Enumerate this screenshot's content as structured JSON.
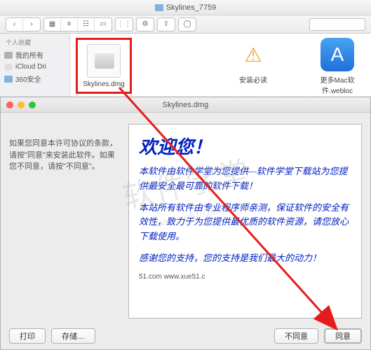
{
  "finder": {
    "title": "Skylines_7759",
    "sidebar": {
      "header": "个人收藏",
      "items": [
        {
          "label": "我的所有"
        },
        {
          "label": "iCloud Dri"
        },
        {
          "label": "360安全"
        }
      ]
    },
    "files": [
      {
        "label": "Skylines.dmg",
        "kind": "dmg"
      },
      {
        "label": "安装必读",
        "kind": "warning"
      },
      {
        "label": "更多Mac软件.webloc",
        "kind": "appstore"
      }
    ]
  },
  "dialog": {
    "title": "Skylines.dmg",
    "instruction": "如果您同意本许可协议的条款，请按\"同意\"来安装此软件。如果您不同意，请按\"不同意\"。",
    "license": {
      "heading": "欢迎您！",
      "p1": "本软件由软件学堂为您提供—软件学堂下载站为您提供最安全最可靠的软件下载！",
      "p2": "本站所有软件由专业程序师亲测，保证软件的安全有效性，致力于为您提供最优质的软件资源，请您放心下载使用。",
      "p3": "感谢您的支持，您的支持是我们最大的动力！",
      "url": "51.com www.xue51.c"
    },
    "buttons": {
      "print": "打印",
      "save": "存储…",
      "disagree": "不同意",
      "agree": "同意"
    }
  },
  "watermark": {
    "main": "软件学堂",
    "sub": "www.xue51.com"
  }
}
